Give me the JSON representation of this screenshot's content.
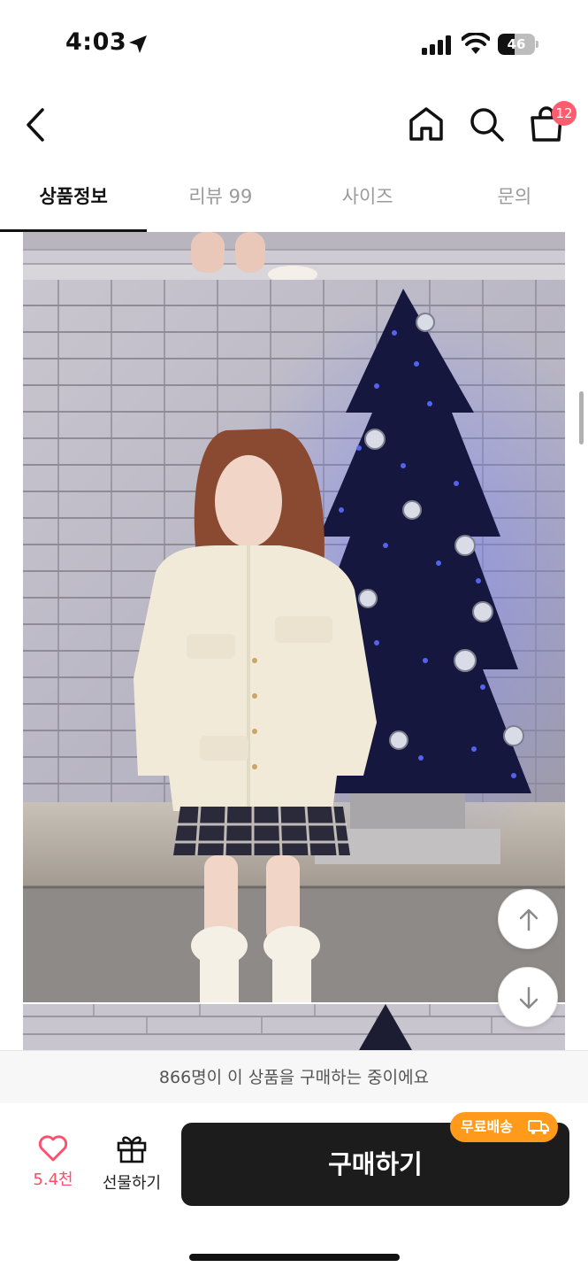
{
  "status_bar": {
    "time": "4:03",
    "battery_level": "46",
    "battery_fraction": 0.46
  },
  "nav": {
    "icons": [
      "back-icon",
      "home-icon",
      "search-icon",
      "shopping-bag-icon"
    ],
    "cart_count": "12"
  },
  "tabs": [
    {
      "label": "상품정보",
      "active": true
    },
    {
      "label": "리뷰 99",
      "active": false
    },
    {
      "label": "사이즈",
      "active": false
    },
    {
      "label": "문의",
      "active": false
    }
  ],
  "content": {
    "scroll_buttons": [
      "arrow-up-icon",
      "arrow-down-icon"
    ]
  },
  "buyer_banner": "866명이 이 상품을 구매하는 중이에요",
  "bottom_bar": {
    "like_count": "5.4천",
    "gift_label": "선물하기",
    "buy_label": "구매하기",
    "free_shipping_label": "무료배송"
  },
  "colors": {
    "accent_pink": "#ff4d6a",
    "badge": "#ff5c70",
    "free_shipping": "#ff9a1a",
    "buy_button": "#1c1c1c"
  }
}
